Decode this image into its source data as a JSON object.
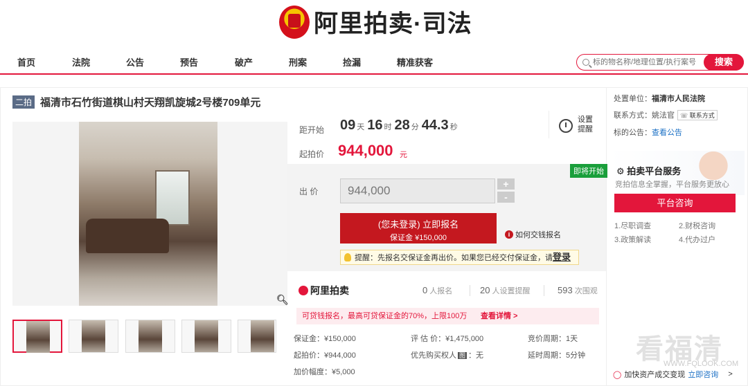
{
  "header": {
    "logo_text": "阿里拍卖·司法"
  },
  "nav": {
    "items": [
      "首页",
      "法院",
      "公告",
      "预告",
      "破产",
      "刑案",
      "捡漏",
      "精准获客"
    ]
  },
  "search": {
    "placeholder": "标的物名称/地理位置/执行案号",
    "button": "搜索"
  },
  "item": {
    "tag": "二拍",
    "title": "福清市石竹街道棋山村天翔凯旋城2号楼709单元"
  },
  "countdown": {
    "label": "距开始",
    "days": "09",
    "days_unit": "天",
    "hours": "16",
    "hours_unit": "时",
    "minutes": "28",
    "minutes_unit": "分",
    "seconds": "44.3",
    "seconds_unit": "秒"
  },
  "start_price": {
    "label": "起拍价",
    "value": "944,000",
    "unit": "元"
  },
  "remind": {
    "label": "设置提醒"
  },
  "bid": {
    "soon_badge": "即将开始",
    "label": "出 价",
    "value": "944,000",
    "plus": "+",
    "minus": "-"
  },
  "signup": {
    "line1": "(您未登录) 立即报名",
    "line2": "保证金 ¥150,000"
  },
  "howto": {
    "text": "如何交钱报名"
  },
  "tip": {
    "text": "提醒：先报名交保证金再出价。如果您已经交付保证金，请",
    "login": "登录"
  },
  "stats": {
    "brand": "阿里拍卖",
    "signups": "0",
    "signups_unit": "人报名",
    "reminders": "20",
    "reminders_unit": "人设置提醒",
    "views": "593",
    "views_unit": "次围观"
  },
  "promo": {
    "text": "可贷钱报名，最高可贷保证金的70%，上限100万",
    "more": "查看详情 >"
  },
  "details": {
    "deposit": "保证金：¥150,000",
    "start": "起拍价：¥944,000",
    "increment": "加价幅度：¥5,000",
    "appraisal": "评 估 价：¥1,475,000",
    "priority": "优先购买权人",
    "priority_icon": "图",
    "priority_value": "：无",
    "cycle": "竞价周期：1天",
    "delay": "延时周期：5分钟"
  },
  "sidebar": {
    "unit_label": "处置单位：",
    "unit_value": "福清市人民法院",
    "contact_label": "联系方式：",
    "contact_name": "姚法官",
    "contact_btn": "☏ 联系方式",
    "notice_label": "标的公告：",
    "notice_link": "查看公告",
    "service_title": "拍卖平台服务",
    "service_sub": "竞拍信息全掌握，平台服务更放心",
    "consult_btn": "平台咨询",
    "services": [
      "1.尽职调查",
      "2.财税咨询",
      "3.政策解读",
      "4.代办过户"
    ],
    "bottom_text": "加快资产成交变现",
    "bottom_link": "立即咨询",
    "bottom_arrow": ">"
  },
  "watermark": {
    "main": "看福清",
    "sub": "WWW.FQLOOK.COM"
  }
}
